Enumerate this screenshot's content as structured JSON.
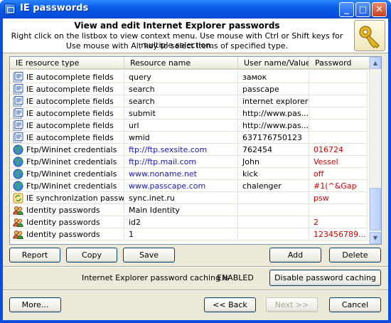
{
  "window": {
    "title": "IE passwords",
    "minimize_glyph": "_",
    "maximize_glyph": "□",
    "close_glyph": "✕"
  },
  "header": {
    "title": "View and edit Internet Explorer passwords",
    "line1": "Right click on the listbox to view context menu. Use mouse with Ctrl or Shift keys for multiple selection.",
    "line2": "Use mouse with Alt key to select items of specified type.",
    "icon": "key-icon"
  },
  "table": {
    "columns": [
      "IE resource type",
      "Resource name",
      "User name/Value",
      "Password"
    ],
    "rows": [
      {
        "type": "IE autocomplete fields",
        "resource": "query",
        "user": "замок",
        "password": "",
        "icon": "autocomplete-icon",
        "resource_color": "",
        "password_color": ""
      },
      {
        "type": "IE autocomplete fields",
        "resource": "search",
        "user": "passcape",
        "password": "",
        "icon": "autocomplete-icon",
        "resource_color": "",
        "password_color": ""
      },
      {
        "type": "IE autocomplete fields",
        "resource": "search",
        "user": "internet explorer ...",
        "password": "",
        "icon": "autocomplete-icon",
        "resource_color": "",
        "password_color": ""
      },
      {
        "type": "IE autocomplete fields",
        "resource": "submit",
        "user": "http://www.pas...",
        "password": "",
        "icon": "autocomplete-icon",
        "resource_color": "",
        "password_color": ""
      },
      {
        "type": "IE autocomplete fields",
        "resource": "url",
        "user": "http://www.pas...",
        "password": "",
        "icon": "autocomplete-icon",
        "resource_color": "",
        "password_color": ""
      },
      {
        "type": "IE autocomplete fields",
        "resource": "wmid",
        "user": "637176750123",
        "password": "",
        "icon": "autocomplete-icon",
        "resource_color": "",
        "password_color": ""
      },
      {
        "type": "Ftp/Wininet credentials",
        "resource": "ftp://ftp.sexsite.com",
        "user": "762454",
        "password": "016724",
        "icon": "globe-icon",
        "resource_color": "blue",
        "password_color": "red"
      },
      {
        "type": "Ftp/Wininet credentials",
        "resource": "ftp://ftp.mail.com",
        "user": "John",
        "password": "Vessel",
        "icon": "globe-icon",
        "resource_color": "blue",
        "password_color": "red"
      },
      {
        "type": "Ftp/Wininet credentials",
        "resource": "www.noname.net",
        "user": "kick",
        "password": "off",
        "icon": "globe-icon",
        "resource_color": "blue",
        "password_color": "red"
      },
      {
        "type": "Ftp/Wininet credentials",
        "resource": "www.passcape.com",
        "user": "chalenger",
        "password": "#1(^&Gap",
        "icon": "globe-icon",
        "resource_color": "blue",
        "password_color": "red"
      },
      {
        "type": "IE synchronization passwo...",
        "resource": "sync.inet.ru",
        "user": "",
        "password": "psw",
        "icon": "sync-icon",
        "resource_color": "",
        "password_color": "red"
      },
      {
        "type": "Identity passwords",
        "resource": "Main Identity",
        "user": "",
        "password": "",
        "icon": "identity-icon",
        "resource_color": "",
        "password_color": ""
      },
      {
        "type": "Identity passwords",
        "resource": "id2",
        "user": "",
        "password": "2",
        "icon": "identity-icon",
        "resource_color": "",
        "password_color": "red"
      },
      {
        "type": "Identity passwords",
        "resource": "1",
        "user": "",
        "password": "123456789...",
        "icon": "identity-icon",
        "resource_color": "",
        "password_color": "red"
      }
    ]
  },
  "buttons": {
    "report": "Report",
    "copy": "Copy",
    "save": "Save",
    "add": "Add",
    "delete": "Delete",
    "disable_caching": "Disable password caching",
    "more": "More...",
    "back": "<< Back",
    "next": "Next >>",
    "cancel": "Cancel"
  },
  "status": {
    "caching_label": "Internet Explorer password caching is",
    "caching_value": "ENABLED"
  },
  "colors": {
    "blue": "#1a1ab8",
    "red": "#d40000",
    "title_bar": "#0a5ee8",
    "dialog_bg": "#ece9d8"
  }
}
